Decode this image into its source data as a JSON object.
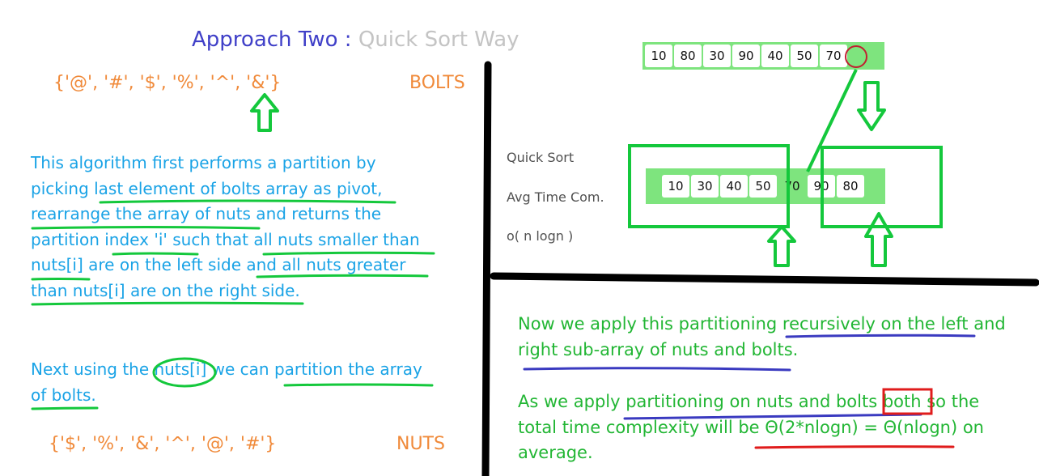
{
  "title": {
    "main": "Approach Two : ",
    "sub": "Quick Sort Way"
  },
  "bolts": {
    "array_text": "{'@', '#', '$', '%', '^', '&'}",
    "label": "BOLTS"
  },
  "nuts": {
    "array_text": "{'$', '%', '&', '^', '@', '#'}",
    "label": "NUTS"
  },
  "explanation": {
    "lines": [
      "This algorithm first performs a partition by",
      "picking last element of bolts array as pivot,",
      "rearrange the array of nuts and returns the",
      "partition index 'i' such that all nuts smaller than",
      "nuts[i] are on the left side and all nuts greater",
      "than nuts[i] are on the right side."
    ],
    "next_line_1": "Next using the nuts[i] we can partition the array",
    "next_line_2": "of bolts."
  },
  "side_labels": {
    "quick_sort": "Quick Sort",
    "avg_time": "Avg Time Com.",
    "complexity": "o( n logn )"
  },
  "top_array": [
    "10",
    "80",
    "30",
    "90",
    "40",
    "50",
    "70"
  ],
  "partitioned_array": [
    "10",
    "30",
    "40",
    "50",
    "70",
    "90",
    "80"
  ],
  "summary": {
    "para1_line1": "Now we apply this partitioning recursively on the left and",
    "para1_line2": "right sub-array of nuts and bolts.",
    "para2_line1": "As we apply partitioning on nuts and bolts both so the",
    "para2_line2": "total time complexity will be Θ(2*nlogn) = Θ(nlogn) on",
    "para2_line3": "average."
  },
  "colors": {
    "title": "#4040c8",
    "subtitle": "#c4c4c4",
    "orange": "#f08a3a",
    "blue_text": "#1aa3e6",
    "green_text": "#22b634",
    "annotation_green": "#14c83c",
    "annotation_blue": "#3a3ac0",
    "annotation_red": "#e01c1c"
  }
}
